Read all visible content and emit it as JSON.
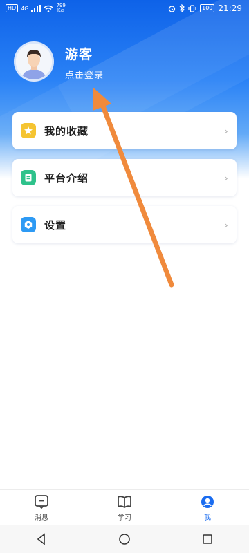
{
  "status_bar": {
    "hd_label": "HD",
    "net_label": "4G",
    "speed_value": "799",
    "speed_unit": "K/s",
    "battery": "100",
    "time": "21:29"
  },
  "profile": {
    "name": "游客",
    "login_prompt": "点击登录"
  },
  "menu": [
    {
      "label": "我的收藏",
      "icon": "star-icon",
      "icon_color": "#f5c431"
    },
    {
      "label": "平台介绍",
      "icon": "document-icon",
      "icon_color": "#2ec28b"
    },
    {
      "label": "设置",
      "icon": "gear-icon",
      "icon_color": "#2d9af4"
    }
  ],
  "tabs": [
    {
      "label": "消息",
      "icon": "message-icon",
      "active": false
    },
    {
      "label": "学习",
      "icon": "book-icon",
      "active": false
    },
    {
      "label": "我",
      "icon": "user-icon",
      "active": true
    }
  ],
  "colors": {
    "accent": "#1a6cf0",
    "arrow": "#f08a3c"
  }
}
